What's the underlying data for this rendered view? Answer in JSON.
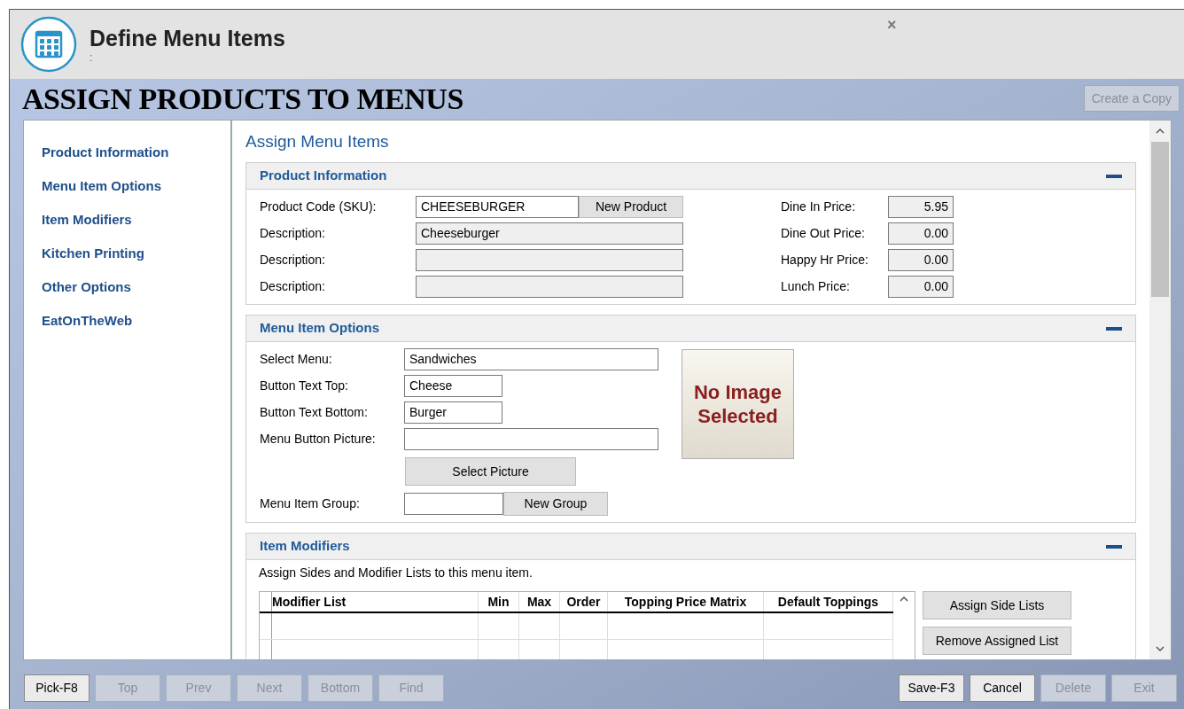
{
  "window": {
    "title": "Define Menu Items",
    "subtitle": ":",
    "close": "×"
  },
  "page_title": "ASSIGN PRODUCTS TO MENUS",
  "create_copy": {
    "label": "Create a Copy",
    "disabled": true
  },
  "sidebar": {
    "items": [
      {
        "label": "Product Information"
      },
      {
        "label": "Menu Item Options"
      },
      {
        "label": "Item Modifiers"
      },
      {
        "label": "Kitchen Printing"
      },
      {
        "label": "Other Options"
      },
      {
        "label": "EatOnTheWeb"
      }
    ]
  },
  "main_title": "Assign Menu Items",
  "product_information": {
    "title": "Product Information",
    "sku_label": "Product Code (SKU):",
    "sku": "CHEESEBURGER",
    "new_product": "New Product",
    "descriptions": [
      {
        "label": "Description:",
        "value": "Cheeseburger"
      },
      {
        "label": "Description:"
      },
      {
        "label": "Description:"
      }
    ],
    "prices": [
      {
        "label": "Dine In Price:",
        "value": "5.95"
      },
      {
        "label": "Dine Out Price:",
        "value": "0.00"
      },
      {
        "label": "Happy Hr Price:",
        "value": "0.00"
      },
      {
        "label": "Lunch Price:",
        "value": "0.00"
      }
    ]
  },
  "menu_item_options": {
    "title": "Menu Item Options",
    "select_menu_label": "Select Menu:",
    "select_menu": "Sandwiches",
    "text_top_label": "Button Text Top:",
    "text_top": "Cheese",
    "text_bottom_label": "Button Text Bottom:",
    "text_bottom": "Burger",
    "picture_label": "Menu Button Picture:",
    "select_picture": "Select Picture",
    "group_label": "Menu Item Group:",
    "new_group": "New Group",
    "no_image": "No Image Selected"
  },
  "item_modifiers": {
    "title": "Item Modifiers",
    "note": "Assign Sides and Modifier Lists to this menu item.",
    "columns": [
      "Modifier List",
      "Min",
      "Max",
      "Order",
      "Topping Price Matrix",
      "Default Toppings"
    ],
    "buttons": [
      "Assign Side Lists",
      "Remove Assigned List"
    ]
  },
  "footer_left": [
    {
      "label": "Pick-F8",
      "disabled": false
    },
    {
      "label": "Top",
      "disabled": true
    },
    {
      "label": "Prev",
      "disabled": true
    },
    {
      "label": "Next",
      "disabled": true
    },
    {
      "label": "Bottom",
      "disabled": true
    },
    {
      "label": "Find",
      "disabled": true
    }
  ],
  "footer_right": [
    {
      "label": "Save-F3",
      "disabled": false
    },
    {
      "label": "Cancel",
      "disabled": false
    },
    {
      "label": "Delete",
      "disabled": true
    },
    {
      "label": "Exit",
      "disabled": true
    }
  ]
}
